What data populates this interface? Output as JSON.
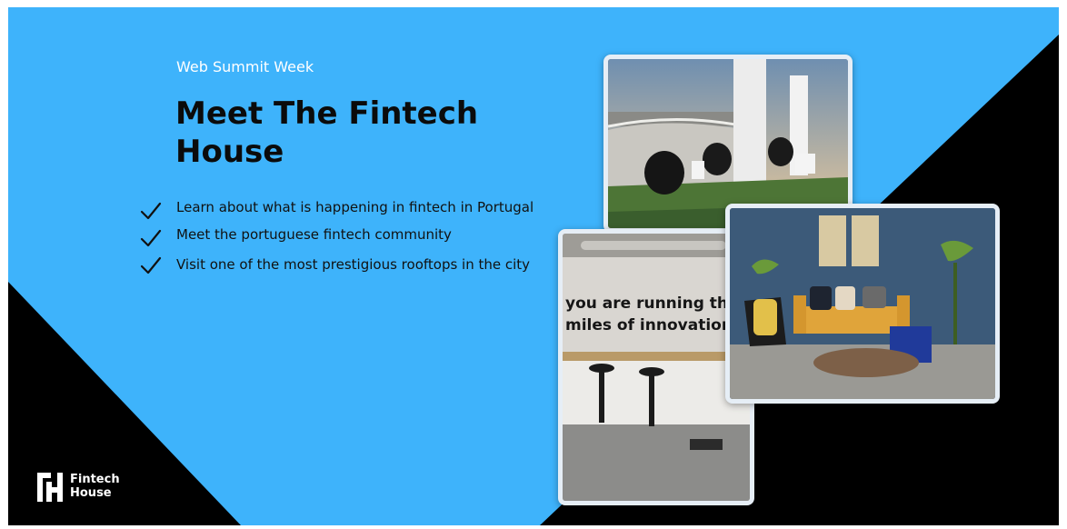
{
  "header": {
    "eyebrow": "Web Summit Week",
    "title": "Meet The Fintech House"
  },
  "features": [
    {
      "text": "Learn about what is happening in fintech in Portugal",
      "icon": "checkmark-icon"
    },
    {
      "text": "Meet the portuguese fintech community",
      "icon": "checkmark-icon"
    },
    {
      "text": "Visit one of the most prestigious rooftops in the city",
      "icon": "checkmark-icon"
    }
  ],
  "photos": {
    "office_wall_line1": "you are running the",
    "office_wall_line2": "miles of innovation."
  },
  "brand": {
    "name_line1": "Fintech",
    "name_line2": "House"
  },
  "colors": {
    "background_blue": "#3eb3fb",
    "background_black": "#000000",
    "text_dark": "#0b0b0b",
    "text_light": "#ffffff"
  }
}
